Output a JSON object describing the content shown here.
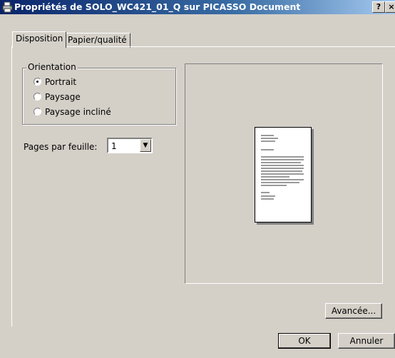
{
  "window": {
    "title": "Propriétés de SOLO_WC421_01_Q sur PICASSO Document",
    "help_button": "?",
    "close_button": "×",
    "icon": "printer-icon"
  },
  "tabs": [
    {
      "label": "Disposition",
      "active": true
    },
    {
      "label": "Papier/qualité",
      "active": false
    }
  ],
  "orientation": {
    "group_label": "Orientation",
    "options": [
      {
        "label": "Portrait",
        "selected": true
      },
      {
        "label": "Paysage",
        "selected": false
      },
      {
        "label": "Paysage incliné",
        "selected": false
      }
    ]
  },
  "pages_per_sheet": {
    "label": "Pages par feuille:",
    "value": "1"
  },
  "buttons": {
    "advanced": "Avancée...",
    "ok": "OK",
    "cancel": "Annuler"
  }
}
